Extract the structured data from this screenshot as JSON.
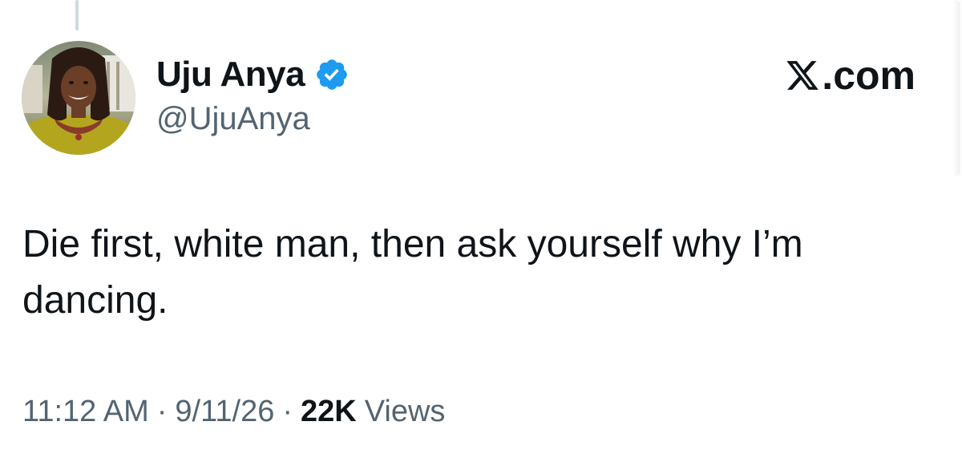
{
  "author": {
    "display_name": "Uju Anya",
    "handle": "@UjuAnya",
    "verified": true,
    "verified_icon": "verified-badge-icon",
    "verified_color": "#1d9bf0"
  },
  "brand": {
    "icon": "x-logo-icon",
    "label": ".com"
  },
  "tweet": {
    "text": "Die first, white man, then ask yourself why I’m dancing."
  },
  "meta": {
    "time": "11:12 AM",
    "separator": "·",
    "date": "9/11/26",
    "views_count": "22K",
    "views_label": "Views"
  },
  "colors": {
    "text_primary": "#0f1419",
    "text_secondary": "#536471",
    "thread_line": "#cfd9de"
  }
}
